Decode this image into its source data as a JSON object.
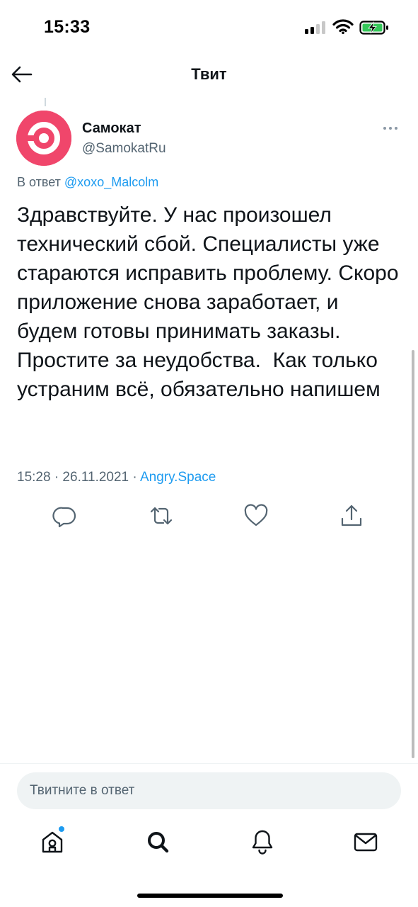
{
  "status_bar": {
    "time": "15:33",
    "icons": [
      "cellular-signal-icon",
      "wifi-icon",
      "battery-charging-icon"
    ]
  },
  "header": {
    "title": "Твит",
    "back_icon": "arrow-left-icon"
  },
  "tweet": {
    "author": {
      "name": "Самокат",
      "handle": "@SamokatRu",
      "avatar_color": "#f0466b"
    },
    "reply_prefix": "В ответ",
    "reply_to": "@xoxo_Malcolm",
    "text": "Здравствуйте. У нас произошел технический сбой. Специалисты уже стараются исправить проблему. Скоро приложение снова заработает, и будем готовы принимать заказы. Простите за неудобства.  Как только устраним всё, обязательно напишем",
    "meta_prefix": "15:28 · 26.11.2021 · ",
    "source": "Angry.Space",
    "actions": [
      "reply-icon",
      "retweet-icon",
      "like-icon",
      "share-icon"
    ]
  },
  "reply_box": {
    "placeholder": "Твитните в ответ"
  },
  "tab_bar": {
    "items": [
      "home-icon",
      "search-icon",
      "notifications-icon",
      "messages-icon"
    ],
    "home_has_new": true
  },
  "colors": {
    "accent": "#1d9bf0",
    "text_primary": "#0f1419",
    "text_secondary": "#536471",
    "brand": "#f0466b"
  }
}
